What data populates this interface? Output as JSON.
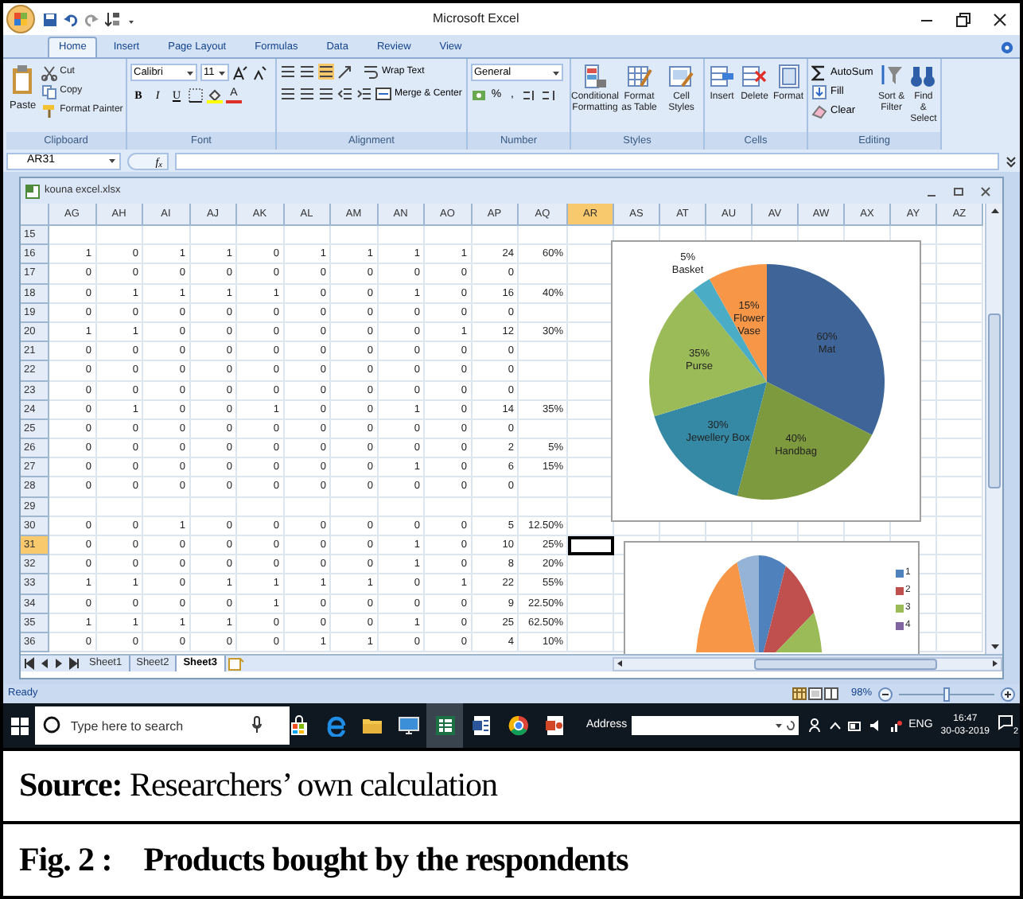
{
  "window": {
    "title": "Microsoft Excel"
  },
  "ribbon_tabs": [
    {
      "label": "Home",
      "selected": true
    },
    {
      "label": "Insert",
      "selected": false
    },
    {
      "label": "Page Layout",
      "selected": false
    },
    {
      "label": "Formulas",
      "selected": false
    },
    {
      "label": "Data",
      "selected": false
    },
    {
      "label": "Review",
      "selected": false
    },
    {
      "label": "View",
      "selected": false
    }
  ],
  "ribbon_groups": [
    {
      "kind": "clipboard",
      "label": "Clipboard",
      "paste": "Paste",
      "small": [
        "Cut",
        "Copy",
        "Format Painter"
      ]
    },
    {
      "kind": "font",
      "label": "Font",
      "font_name": "Calibri",
      "font_size": "11",
      "format_buttons": [
        "B",
        "I",
        "U"
      ],
      "font_color": "A"
    },
    {
      "kind": "alignment",
      "label": "Alignment",
      "wrap": "Wrap Text",
      "merge": "Merge & Center"
    },
    {
      "kind": "number",
      "label": "Number",
      "format": "General",
      "symbols": [
        "%",
        ","
      ]
    },
    {
      "kind": "large",
      "label": "Styles",
      "buttons": [
        "Conditional Formatting",
        "Format as Table",
        "Cell Styles"
      ]
    },
    {
      "kind": "large",
      "label": "Cells",
      "buttons": [
        "Insert",
        "Delete",
        "Format"
      ]
    },
    {
      "kind": "editing",
      "label": "Editing",
      "small": [
        "AutoSum",
        "Fill",
        "Clear"
      ],
      "large": [
        "Sort & Filter",
        "Find & Select"
      ]
    }
  ],
  "formula_bar": {
    "name_box": "AR31",
    "function_label": "f$_{x}$"
  },
  "workbook": {
    "title": "kouna excel.xlsx",
    "columns": [
      {
        "label": "AG",
        "selected": false
      },
      {
        "label": "AH",
        "selected": false
      },
      {
        "label": "AI",
        "selected": false
      },
      {
        "label": "AJ",
        "selected": false
      },
      {
        "label": "AK",
        "selected": false
      },
      {
        "label": "AL",
        "selected": false
      },
      {
        "label": "AM",
        "selected": false
      },
      {
        "label": "AN",
        "selected": false
      },
      {
        "label": "AO",
        "selected": false
      },
      {
        "label": "AP",
        "selected": false
      },
      {
        "label": "AQ",
        "selected": false
      },
      {
        "label": "AR",
        "selected": true
      },
      {
        "label": "AS",
        "selected": false
      },
      {
        "label": "AT",
        "selected": false
      },
      {
        "label": "AU",
        "selected": false
      },
      {
        "label": "AV",
        "selected": false
      },
      {
        "label": "AW",
        "selected": false
      },
      {
        "label": "AX",
        "selected": false
      },
      {
        "label": "AY",
        "selected": false
      },
      {
        "label": "AZ",
        "selected": false
      }
    ],
    "rows": [
      {
        "label": "15",
        "selected": false
      },
      {
        "label": "16",
        "selected": false,
        "cells": [
          "1",
          "0",
          "1",
          "1",
          "0",
          "1",
          "1",
          "1",
          "1",
          "24",
          "60%"
        ]
      },
      {
        "label": "17",
        "selected": false,
        "cells": [
          "0",
          "0",
          "0",
          "0",
          "0",
          "0",
          "0",
          "0",
          "0",
          "0"
        ]
      },
      {
        "label": "18",
        "selected": false,
        "cells": [
          "0",
          "1",
          "1",
          "1",
          "1",
          "0",
          "0",
          "1",
          "0",
          "16",
          "40%"
        ]
      },
      {
        "label": "19",
        "selected": false,
        "cells": [
          "0",
          "0",
          "0",
          "0",
          "0",
          "0",
          "0",
          "0",
          "0",
          "0"
        ]
      },
      {
        "label": "20",
        "selected": false,
        "cells": [
          "1",
          "1",
          "0",
          "0",
          "0",
          "0",
          "0",
          "0",
          "1",
          "12",
          "30%"
        ]
      },
      {
        "label": "21",
        "selected": false,
        "cells": [
          "0",
          "0",
          "0",
          "0",
          "0",
          "0",
          "0",
          "0",
          "0",
          "0"
        ]
      },
      {
        "label": "22",
        "selected": false,
        "cells": [
          "0",
          "0",
          "0",
          "0",
          "0",
          "0",
          "0",
          "0",
          "0",
          "0"
        ]
      },
      {
        "label": "23",
        "selected": false,
        "cells": [
          "0",
          "0",
          "0",
          "0",
          "0",
          "0",
          "0",
          "0",
          "0",
          "0"
        ]
      },
      {
        "label": "24",
        "selected": false,
        "cells": [
          "0",
          "1",
          "0",
          "0",
          "1",
          "0",
          "0",
          "1",
          "0",
          "14",
          "35%"
        ]
      },
      {
        "label": "25",
        "selected": false,
        "cells": [
          "0",
          "0",
          "0",
          "0",
          "0",
          "0",
          "0",
          "0",
          "0",
          "0"
        ]
      },
      {
        "label": "26",
        "selected": false,
        "cells": [
          "0",
          "0",
          "0",
          "0",
          "0",
          "0",
          "0",
          "0",
          "0",
          "2",
          "5%"
        ]
      },
      {
        "label": "27",
        "selected": false,
        "cells": [
          "0",
          "0",
          "0",
          "0",
          "0",
          "0",
          "0",
          "1",
          "0",
          "6",
          "15%"
        ]
      },
      {
        "label": "28",
        "selected": false,
        "cells": [
          "0",
          "0",
          "0",
          "0",
          "0",
          "0",
          "0",
          "0",
          "0",
          "0"
        ]
      },
      {
        "label": "29",
        "selected": false
      },
      {
        "label": "30",
        "selected": false,
        "cells": [
          "0",
          "0",
          "1",
          "0",
          "0",
          "0",
          "0",
          "0",
          "0",
          "5",
          "12.50%"
        ]
      },
      {
        "label": "31",
        "selected": true,
        "cells": [
          "0",
          "0",
          "0",
          "0",
          "0",
          "0",
          "0",
          "1",
          "0",
          "10",
          "25%"
        ]
      },
      {
        "label": "32",
        "selected": false,
        "cells": [
          "0",
          "0",
          "0",
          "0",
          "0",
          "0",
          "0",
          "1",
          "0",
          "8",
          "20%"
        ]
      },
      {
        "label": "33",
        "selected": false,
        "cells": [
          "1",
          "1",
          "0",
          "1",
          "1",
          "1",
          "1",
          "0",
          "1",
          "22",
          "55%"
        ]
      },
      {
        "label": "34",
        "selected": false,
        "cells": [
          "0",
          "0",
          "0",
          "0",
          "1",
          "0",
          "0",
          "0",
          "0",
          "9",
          "22.50%"
        ]
      },
      {
        "label": "35",
        "selected": false,
        "cells": [
          "1",
          "1",
          "1",
          "1",
          "0",
          "0",
          "0",
          "1",
          "0",
          "25",
          "62.50%"
        ]
      },
      {
        "label": "36",
        "selected": false,
        "cells": [
          "0",
          "0",
          "0",
          "0",
          "0",
          "1",
          "1",
          "0",
          "0",
          "4",
          "10%"
        ]
      }
    ],
    "sheets": [
      {
        "label": "Sheet1",
        "selected": false
      },
      {
        "label": "Sheet2",
        "selected": false
      },
      {
        "label": "Sheet3",
        "selected": true
      }
    ],
    "chart_1": {
      "chart_data": {
        "type": "pie",
        "categories": [
          "Mat",
          "Handbag",
          "Jewellery Box",
          "Purse",
          "Basket",
          "Flower Vase"
        ],
        "values": [
          60,
          40,
          30,
          35,
          5,
          15
        ],
        "value_labels": [
          "60%",
          "40%",
          "30%",
          "35%",
          "5%",
          "15%"
        ],
        "colors": [
          "#3f6598",
          "#7d9a3e",
          "#3589a5",
          "#9bbb59",
          "#4bacc6",
          "#f79646"
        ]
      }
    },
    "chart_2": {
      "legend": [
        {
          "label": "1",
          "color": "#4f81bd"
        },
        {
          "label": "2",
          "color": "#c0504d"
        },
        {
          "label": "3",
          "color": "#9bbb59"
        },
        {
          "label": "4",
          "color": "#8064a2"
        }
      ]
    }
  },
  "status_bar": {
    "text": "Ready",
    "zoom": "98%",
    "zoom_slider": {
      "level": 0.5
    }
  },
  "taskbar": {
    "search_placeholder": "Type here to search",
    "address_label": "Address",
    "language": "ENG",
    "time": "16:47",
    "date": "30-03-2019",
    "notification_count": "2"
  },
  "caption": {
    "source": "**Source:** Researchers’ own calculation",
    "figure_number": "Fig. 2 :",
    "figure_title": "Products bought by the respondents"
  }
}
